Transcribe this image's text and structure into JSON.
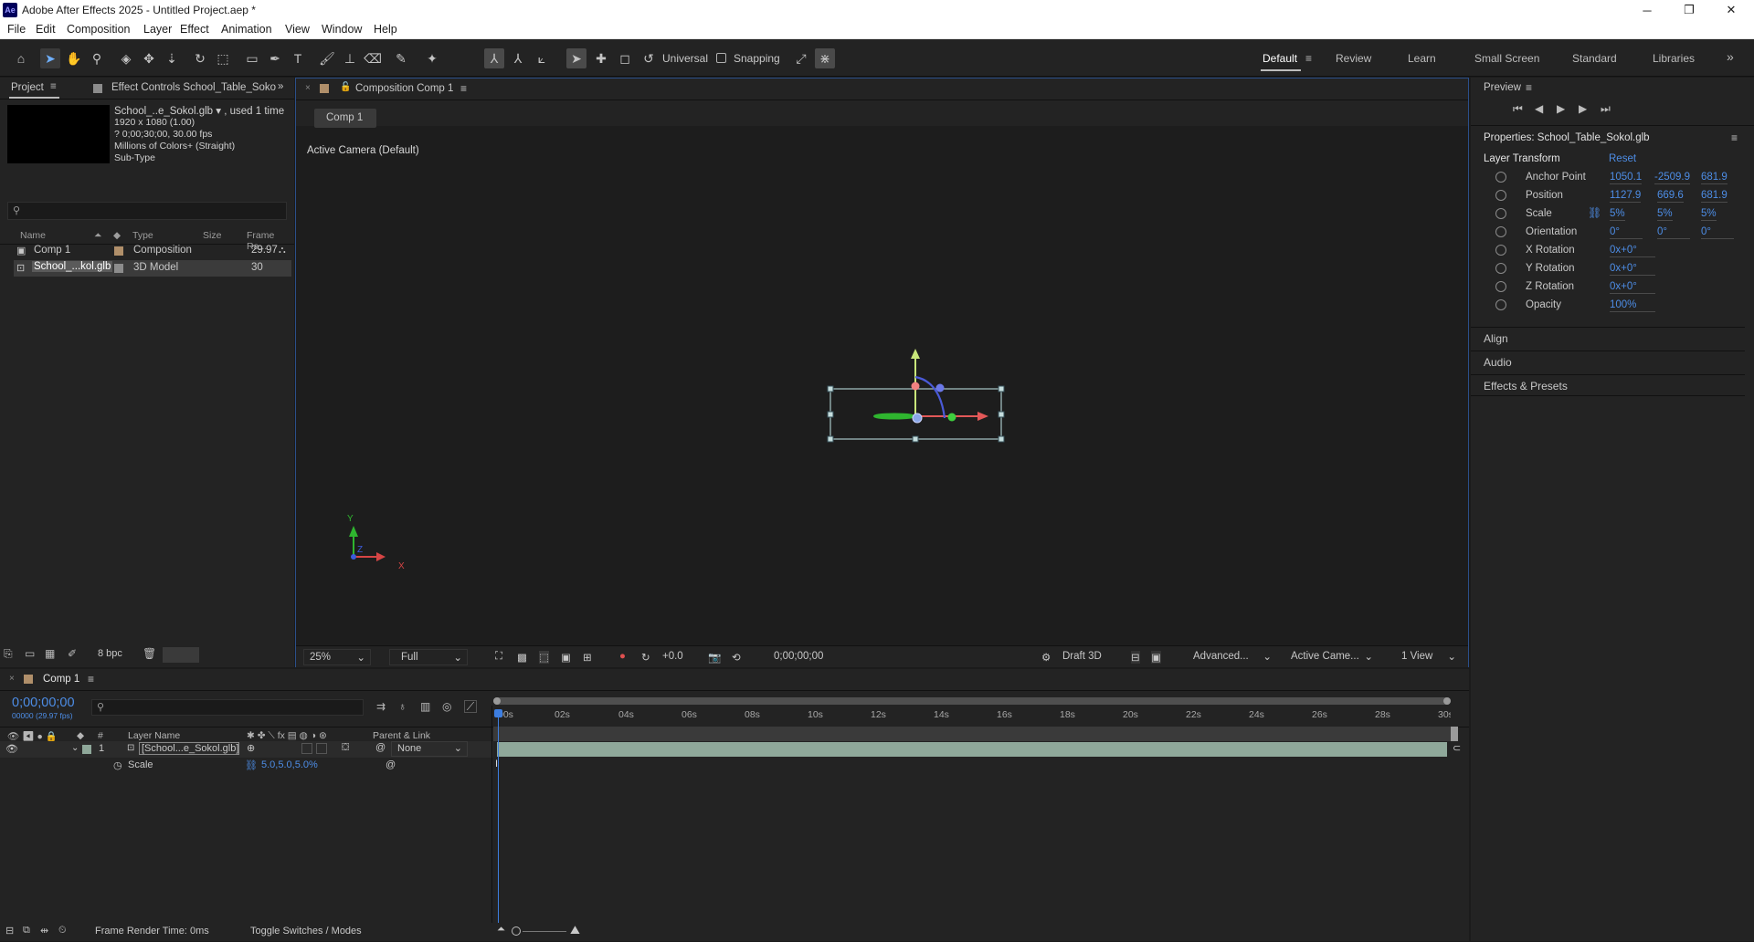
{
  "window": {
    "title": "Adobe After Effects 2025 - Untitled Project.aep *",
    "app_badge": "Ae",
    "controls": {
      "minimize": "─",
      "maximize": "❐",
      "close": "✕"
    }
  },
  "menu": [
    "File",
    "Edit",
    "Composition",
    "Layer",
    "Effect",
    "Animation",
    "View",
    "Window",
    "Help"
  ],
  "toolbar": {
    "axis_mode": "Universal",
    "snapping_label": "Snapping",
    "workspaces": [
      "Default",
      "Review",
      "Learn",
      "Small Screen",
      "Standard",
      "Libraries"
    ],
    "active_workspace": "Default",
    "overflow": "»"
  },
  "project_panel": {
    "tab_project": "Project",
    "tab_effect_controls": "Effect Controls School_Table_Sokol.g",
    "selected_item": {
      "name": "School_..e_Sokol.glb",
      "used": ", used 1 time",
      "dims": "1920 x 1080 (1.00)",
      "duration": "? 0;00;30;00, 30.00 fps",
      "colors": "Millions of Colors+ (Straight)",
      "subtype": "Sub-Type"
    },
    "search_placeholder": "",
    "columns": [
      "Name",
      "Type",
      "Size",
      "Frame Ra..."
    ],
    "items": [
      {
        "name": "Comp 1",
        "type": "Composition",
        "size": "",
        "frame_rate": "29.97",
        "label_color": "#b08f6a"
      },
      {
        "name": "School_...kol.glb",
        "type": "3D Model",
        "size": "",
        "frame_rate": "30",
        "label_color": "#8c8c8c"
      }
    ],
    "bpc": "8 bpc"
  },
  "comp_panel": {
    "tab_label": "Composition Comp 1",
    "breadcrumb": "Comp 1",
    "camera_label": "Active Camera (Default)",
    "footer": {
      "zoom": "25%",
      "resolution": "Full",
      "exposure": "+0.0",
      "timecode": "0;00;00;00",
      "renderer": "Draft 3D",
      "advanced": "Advanced...",
      "camera": "Active Came...",
      "views": "1 View"
    },
    "axis_labels": {
      "x": "X",
      "y": "Y",
      "z": "Z"
    }
  },
  "right_panel": {
    "preview_title": "Preview",
    "properties_title": "Properties: School_Table_Sokol.glb",
    "group_title": "Layer Transform",
    "reset_label": "Reset",
    "properties": [
      {
        "name": "Anchor Point",
        "values": [
          "1050.1",
          "-2509.9",
          "681.9"
        ]
      },
      {
        "name": "Position",
        "values": [
          "1127.9",
          "669.6",
          "681.9"
        ]
      },
      {
        "name": "Scale",
        "values": [
          "5%",
          "5%",
          "5%"
        ]
      },
      {
        "name": "Orientation",
        "values": [
          "0°",
          "0°",
          "0°"
        ]
      },
      {
        "name": "X Rotation",
        "values": [
          "0x+0°"
        ]
      },
      {
        "name": "Y Rotation",
        "values": [
          "0x+0°"
        ]
      },
      {
        "name": "Z Rotation",
        "values": [
          "0x+0°"
        ]
      },
      {
        "name": "Opacity",
        "values": [
          "100%"
        ]
      }
    ],
    "sections": [
      "Align",
      "Audio",
      "Effects & Presets"
    ]
  },
  "timeline": {
    "tab_label": "Comp 1",
    "timecode": "0;00;00;00",
    "timecode_sub": "00000 (29.97 fps)",
    "search_placeholder": "",
    "columns": {
      "layer_name": "Layer Name",
      "parent": "Parent & Link"
    },
    "ruler": [
      "00s",
      "02s",
      "04s",
      "06s",
      "08s",
      "10s",
      "12s",
      "14s",
      "16s",
      "18s",
      "20s",
      "22s",
      "24s",
      "26s",
      "28s",
      "30s"
    ],
    "layer": {
      "index": "1",
      "name": "[School...e_Sokol.glb]",
      "parent": "None",
      "label_color": "#8fa89a"
    },
    "sub_property": {
      "name": "Scale",
      "value": "5.0,5.0,5.0%"
    },
    "footer": {
      "render_time_label": "Frame Render Time:",
      "render_time": "0ms",
      "toggle": "Toggle Switches / Modes"
    }
  }
}
